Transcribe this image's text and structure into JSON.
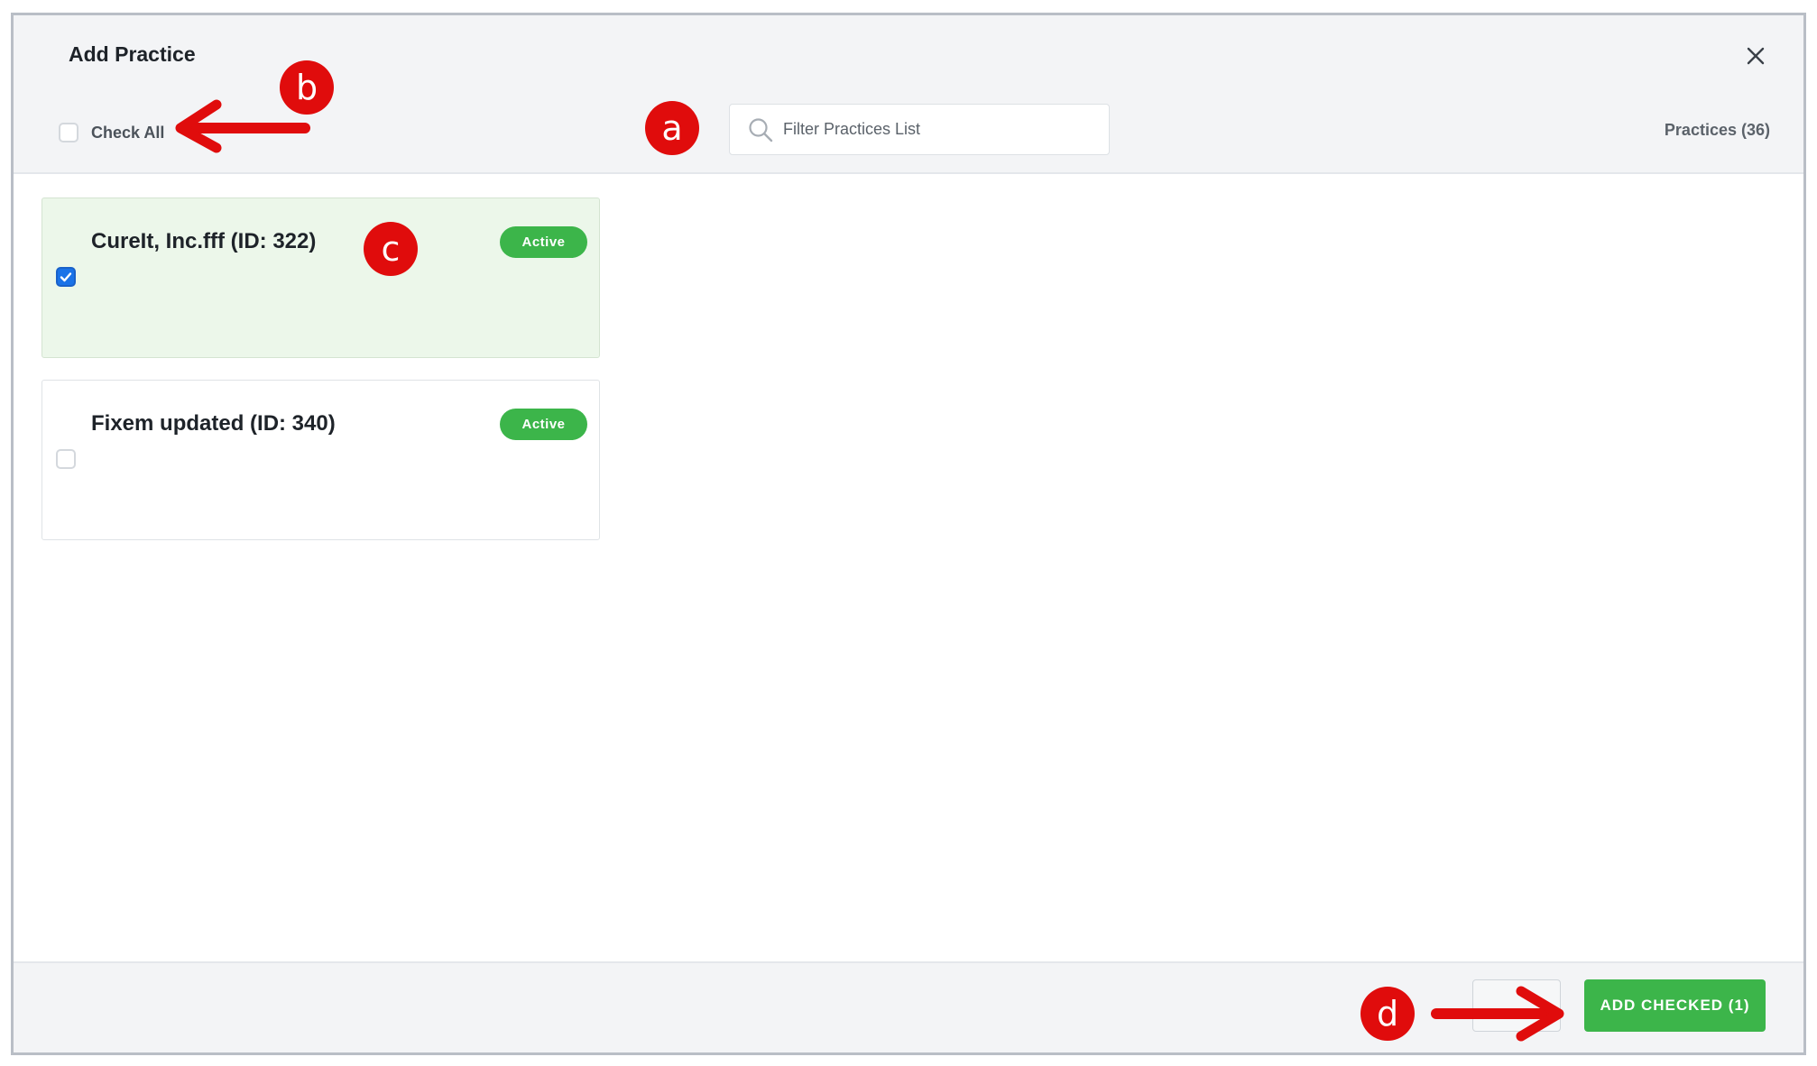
{
  "dialog": {
    "title": "Add Practice",
    "close_icon": "close-icon"
  },
  "toolbar": {
    "check_all_label": "Check All",
    "check_all_checked": false,
    "search": {
      "placeholder": "Filter Practices List",
      "value": "",
      "icon": "search-icon"
    },
    "practices_count": "Practices (36)"
  },
  "practices": [
    {
      "name": "CureIt, Inc.fff (ID: 322)",
      "status": "Active",
      "checked": true
    },
    {
      "name": "Fixem updated (ID: 340)",
      "status": "Active",
      "checked": false
    }
  ],
  "footer": {
    "add_checked_label": "ADD CHECKED (1)"
  },
  "annotations": {
    "a": "a",
    "b": "b",
    "c": "c",
    "d": "d"
  },
  "colors": {
    "accent_green": "#3cb54a",
    "checkbox_blue": "#1a73e8",
    "marker_red": "#e00c0c",
    "selected_card_bg": "#ecf7ea"
  }
}
